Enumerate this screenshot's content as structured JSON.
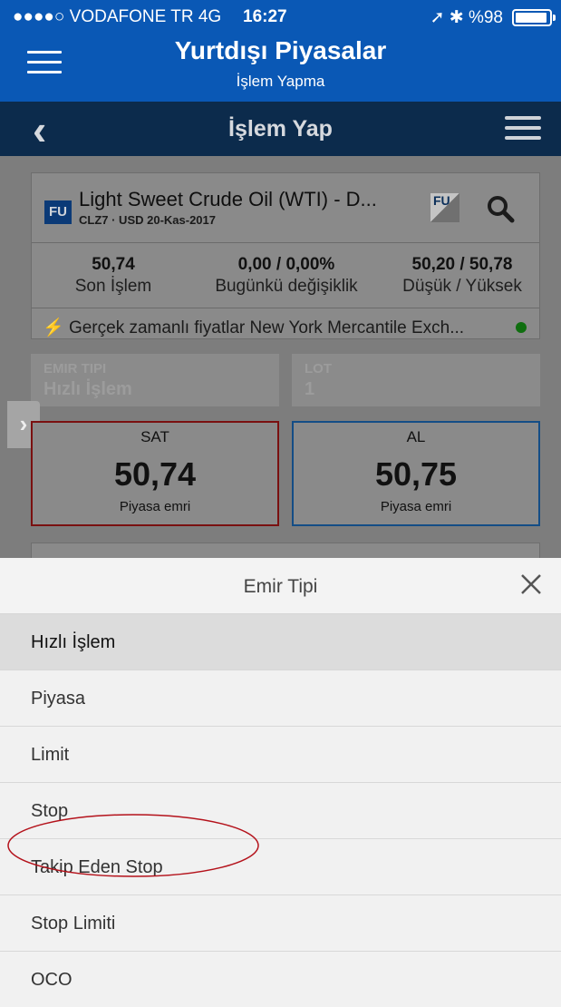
{
  "status_bar": {
    "carrier": "●●●●○ VODAFONE TR  4G",
    "time": "16:27",
    "battery": "➚ ✱ %98"
  },
  "app_header": {
    "title": "Yurtdışı Piyasalar",
    "subtitle": "İşlem Yapma"
  },
  "nav": {
    "back_icon": "‹",
    "title": "İşlem Yap"
  },
  "instrument": {
    "badge": "FU",
    "name": "Light Sweet Crude Oil (WTI) - D...",
    "code": "CLZ7",
    "details": " · USD  20-Kas-2017",
    "badge2": "FU",
    "stats": [
      {
        "value": "50,74",
        "label": "Son İşlem"
      },
      {
        "value": "0,00 / 0,00%",
        "label": "Bugünkü değişiklik"
      },
      {
        "value": "50,20 / 50,78",
        "label": "Düşük / Yüksek"
      }
    ],
    "realtime_text": "Gerçek zamanlı fiyatlar New York Mercantile Exch..."
  },
  "order_form": {
    "order_type_label": "EMIR TIPI",
    "order_type_value": "Hızlı İşlem",
    "lot_label": "LOT",
    "lot_value": "1"
  },
  "sell": {
    "label": "SAT",
    "price": "50,74",
    "sub": "Piyasa emri"
  },
  "buy": {
    "label": "AL",
    "price": "50,75",
    "sub": "Piyasa emri"
  },
  "sheet": {
    "title": "Emir Tipi",
    "options": [
      "Hızlı İşlem",
      "Piyasa",
      "Limit",
      "Stop",
      "Takip Eden Stop",
      "Stop Limiti",
      "OCO"
    ],
    "selected_index": 0,
    "highlighted_option": "Stop Limiti"
  },
  "colors": {
    "header_blue": "#0a58b5",
    "nav_dark": "#0c2b4c",
    "annotation_red": "#b4121b"
  }
}
